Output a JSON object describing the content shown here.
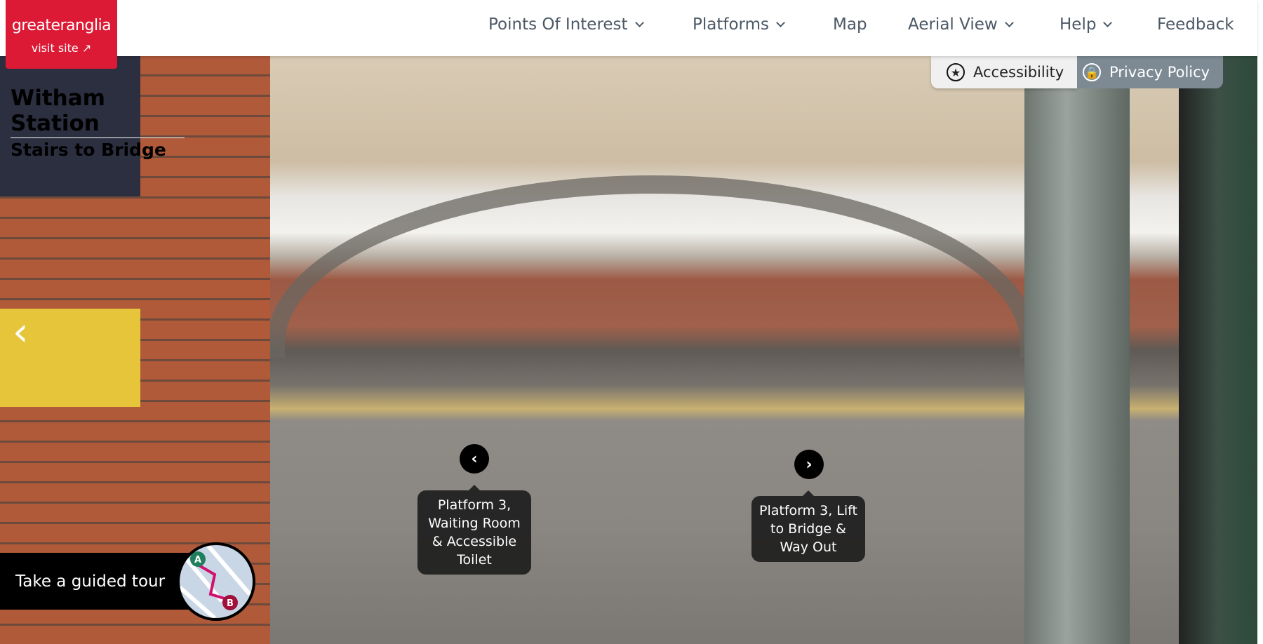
{
  "logo": {
    "brand": "greateranglia",
    "visit_label": "visit site",
    "color": "#dc1a36"
  },
  "nav": [
    {
      "label": "Points Of Interest",
      "dropdown": true
    },
    {
      "label": "Platforms",
      "dropdown": true
    },
    {
      "label": "Map",
      "dropdown": false
    },
    {
      "label": "Aerial View",
      "dropdown": true
    },
    {
      "label": "Help",
      "dropdown": true
    },
    {
      "label": "Feedback",
      "dropdown": false
    }
  ],
  "utility": {
    "accessibility": "Accessibility",
    "privacy": "Privacy Policy"
  },
  "location": {
    "station": "Witham Station",
    "scene": "Stairs to Bridge"
  },
  "hotspots": [
    {
      "icon": "chevron-left-icon",
      "label": "Platform 3, Waiting Room & Accessible Toilet"
    },
    {
      "icon": "chevron-right-icon",
      "label": "Platform 3, Lift to Bridge & Way Out"
    }
  ],
  "tour": {
    "label": "Take a guided tour",
    "pins": [
      "A",
      "B"
    ]
  }
}
